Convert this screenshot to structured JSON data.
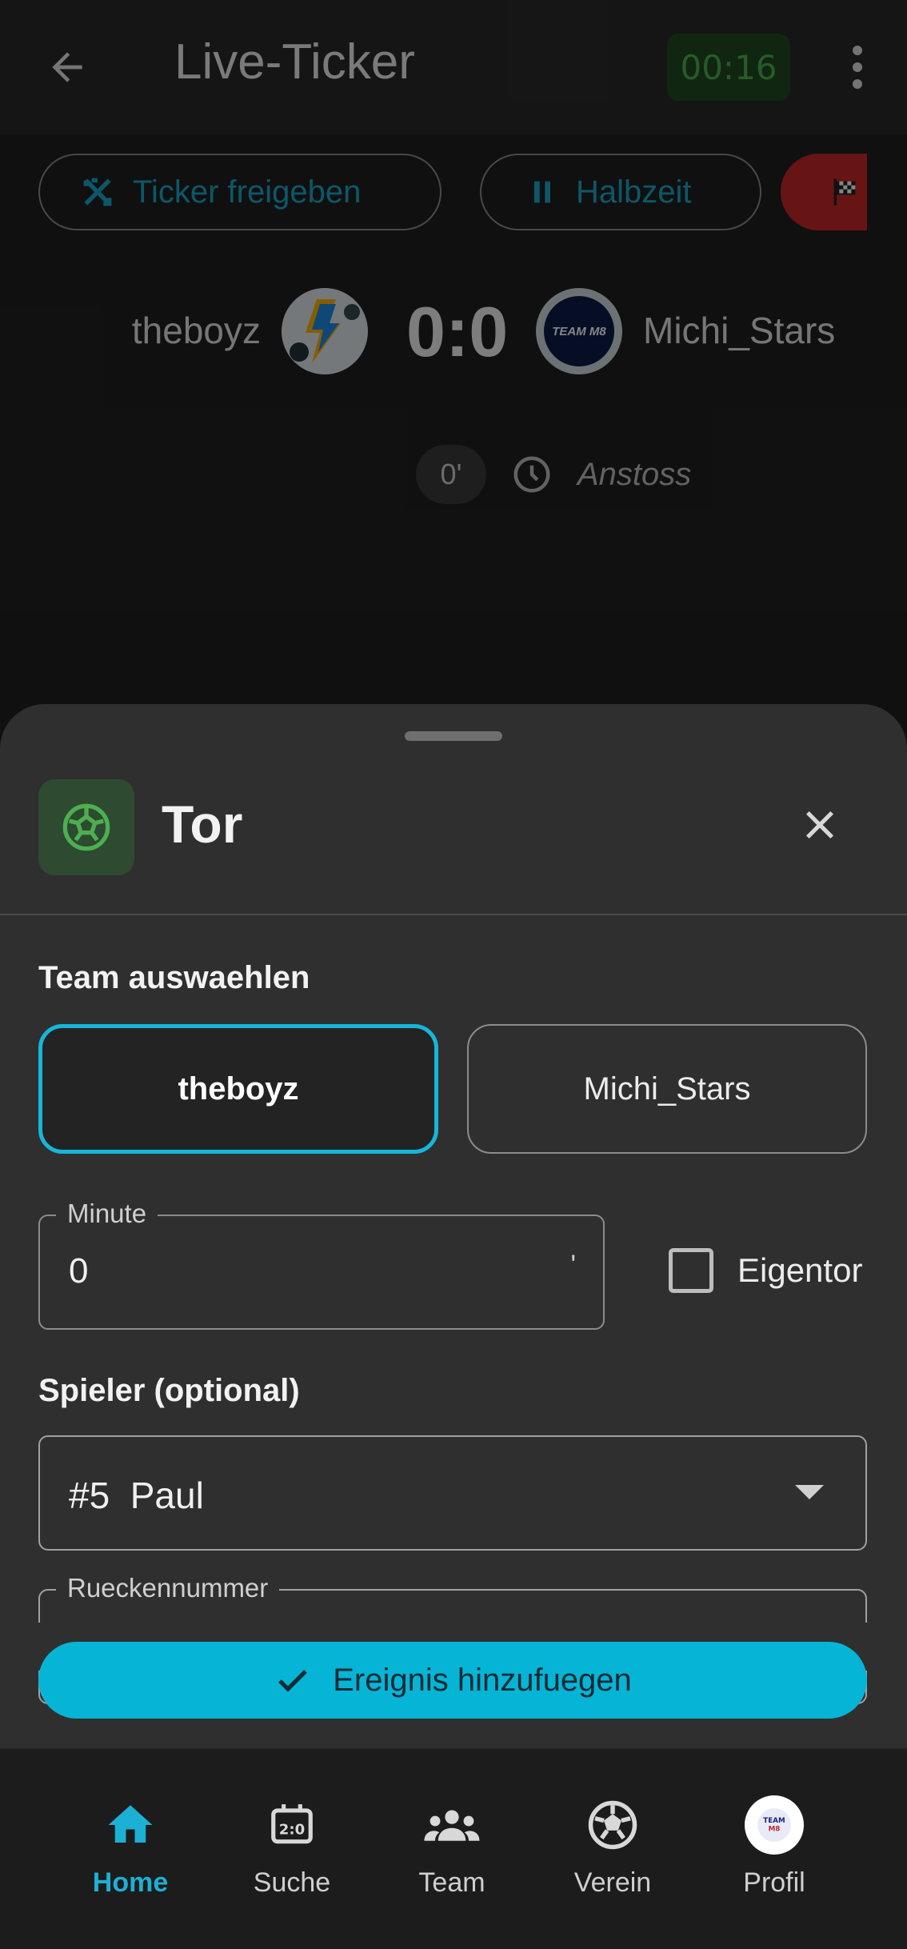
{
  "appbar": {
    "title": "Live-Ticker",
    "timer": "00:16"
  },
  "actions": {
    "share_label": "Ticker freigeben",
    "halftime_label": "Halbzeit"
  },
  "match": {
    "home_team": "theboyz",
    "away_team": "Michi_Stars",
    "score": "0:0",
    "away_logo_text": "TEAM M8"
  },
  "last_event": {
    "minute": "0'",
    "text": "Anstoss"
  },
  "sheet": {
    "title": "Tor",
    "team_section_label": "Team auswaehlen",
    "team_options": [
      "theboyz",
      "Michi_Stars"
    ],
    "selected_team": "theboyz",
    "minute_label": "Minute",
    "minute_value": "0",
    "minute_suffix": "'",
    "own_goal_label": "Eigentor",
    "own_goal_checked": false,
    "player_section_label": "Spieler (optional)",
    "player_value": "#5  Paul",
    "back_number_label": "Rueckennummer",
    "submit_label": "Ereignis hinzufuegen"
  },
  "bottom_nav": {
    "items": [
      {
        "label": "Home",
        "icon": "home-icon",
        "active": true
      },
      {
        "label": "Suche",
        "icon": "scoreboard-icon",
        "active": false
      },
      {
        "label": "Team",
        "icon": "group-icon",
        "active": false
      },
      {
        "label": "Verein",
        "icon": "soccer-ball-icon",
        "active": false
      },
      {
        "label": "Profil",
        "icon": "avatar",
        "active": false
      }
    ]
  },
  "colors": {
    "accent": "#06b4d6",
    "timer_green": "#4caf50",
    "end_button_red": "#c62828",
    "goal_icon_green": "#4caf50"
  }
}
